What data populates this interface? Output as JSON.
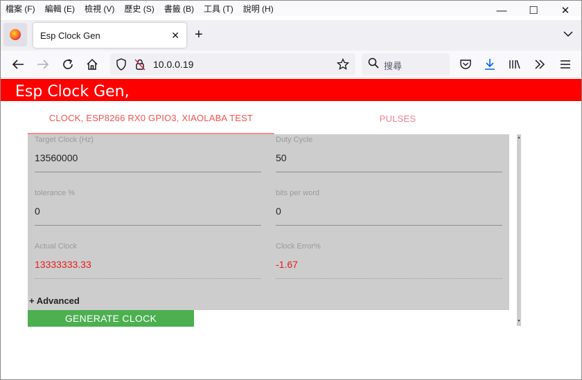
{
  "menu": [
    "檔案 (F)",
    "編輯 (E)",
    "檢視 (V)",
    "歷史 (S)",
    "書籤 (B)",
    "工具 (T)",
    "說明 (H)"
  ],
  "window_controls": {
    "minimize": "—",
    "maximize": "☐",
    "close": "✕"
  },
  "browser": {
    "tab_title": "Esp Clock Gen",
    "tab_close": "✕",
    "new_tab": "+",
    "url": "10.0.0.19",
    "search_placeholder": "搜尋"
  },
  "app": {
    "title": "Esp Clock Gen,",
    "tabs": [
      {
        "label": "CLOCK, ESP8266 RX0 GPIO3, XIAOLABA TEST",
        "active": true
      },
      {
        "label": "PULSES",
        "active": false
      }
    ],
    "fields": {
      "target_clock": {
        "label": "Target Clock (Hz)",
        "value": "13560000"
      },
      "duty_cycle": {
        "label": "Duty Cycle",
        "value": "50"
      },
      "tolerance": {
        "label": "tolerance %",
        "value": "0"
      },
      "bits_per_word": {
        "label": "bits per word",
        "value": "0"
      },
      "actual_clock": {
        "label": "Actual Clock",
        "value": "13333333.33"
      },
      "clock_error": {
        "label": "Clock Error%",
        "value": "-1.67"
      }
    },
    "advanced_label": "+ Advanced",
    "generate_button": "GENERATE CLOCK"
  },
  "colors": {
    "header_red": "#ff0000",
    "tab_text": "#ef5350",
    "panel_bg": "#cdcdcd",
    "error_text": "#e51c1c",
    "button_green": "#4caf50"
  }
}
